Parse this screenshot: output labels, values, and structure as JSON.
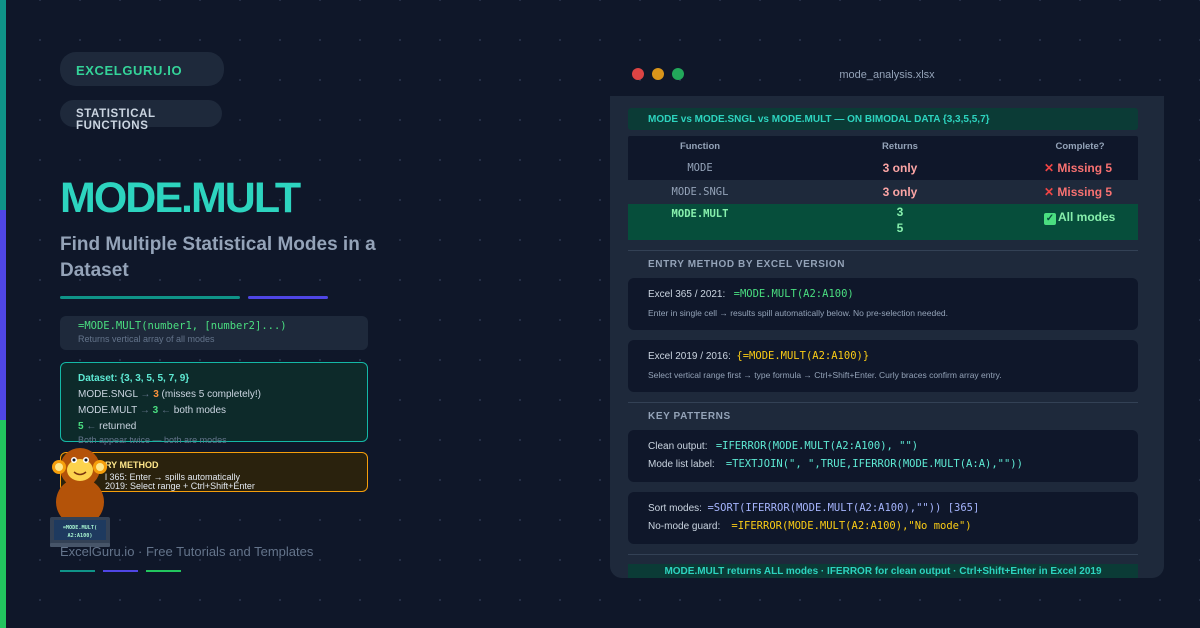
{
  "brand": {
    "badge": "EXCELGURU.IO",
    "category": "STATISTICAL FUNCTIONS"
  },
  "hero": {
    "title": "MODE.MULT",
    "subtitle": "Find Multiple Statistical Modes in a Dataset"
  },
  "syntax": {
    "code": "=MODE.MULT(number1, [number2]...)",
    "note": "Returns vertical array of all modes"
  },
  "dataset_box": {
    "heading": "Dataset: {3, 3, 5, 5, 7, 9}",
    "sngl_label": "MODE.SNGL",
    "sngl_value": "3",
    "sngl_note": "(misses 5 completely!)",
    "mult_label": "MODE.MULT",
    "mult_value1": "3",
    "mult_note": "both modes",
    "mult_value2": "5",
    "returned": "returned",
    "footnote": "Both appear twice — both are modes"
  },
  "entry_box": {
    "heading": "RY METHOD",
    "line1": "l 365: Enter → spills automatically",
    "line2": "2019: Select range + Ctrl+Shift+Enter"
  },
  "mascot": {
    "screen_line1": "=MODE.MULT(",
    "screen_line2": "A2:A100)"
  },
  "footer": {
    "text": "ExcelGuru.io · Free Tutorials and Templates"
  },
  "window": {
    "filename": "mode_analysis.xlsx",
    "title": "MODE vs MODE.SNGL vs MODE.MULT — ON BIMODAL DATA {3,3,5,5,7}",
    "table": {
      "headers": [
        "Function",
        "Returns",
        "Complete?"
      ],
      "rows": [
        {
          "function": "MODE",
          "returns": "3 only",
          "complete": "Missing 5"
        },
        {
          "function": "MODE.SNGL",
          "returns": "3 only",
          "complete": "Missing 5"
        },
        {
          "function": "MODE.MULT",
          "returns_line1": "3",
          "returns_line2": "5",
          "complete": "All modes"
        }
      ]
    },
    "entry_section": {
      "heading": "ENTRY METHOD BY EXCEL VERSION",
      "excel365": {
        "label": "Excel 365 / 2021:",
        "formula": "=MODE.MULT(A2:A100)",
        "note": "Enter in single cell → results spill automatically below. No pre-selection needed."
      },
      "excel2019": {
        "label": "Excel 2019 / 2016:",
        "formula": "{=MODE.MULT(A2:A100)}",
        "note": "Select vertical range first → type formula → Ctrl+Shift+Enter. Curly braces confirm array entry."
      }
    },
    "patterns_section": {
      "heading": "KEY PATTERNS",
      "clean_label": "Clean output:",
      "clean_formula": "=IFERROR(MODE.MULT(A2:A100), \"\")",
      "list_label": "Mode list label:",
      "list_formula": "=TEXTJOIN(\", \",TRUE,IFERROR(MODE.MULT(A:A),\"\"))",
      "sort_label": "Sort modes:",
      "sort_formula": "=SORT(IFERROR(MODE.MULT(A2:A100),\"\")) [365]",
      "guard_label": "No-mode guard:",
      "guard_formula_a": "=IFERROR(MODE.MULT(A2:A100),",
      "guard_formula_b": "\"No mode\")"
    },
    "footer": "MODE.MULT returns ALL modes · IFERROR for clean output · Ctrl+Shift+Enter in Excel 2019"
  },
  "colors": {
    "background": "#0f1729",
    "teal": "#2dd4bf",
    "green": "#4ade80",
    "indigo": "#4f46e5",
    "amber": "#f59e0b",
    "red": "#f87171"
  }
}
